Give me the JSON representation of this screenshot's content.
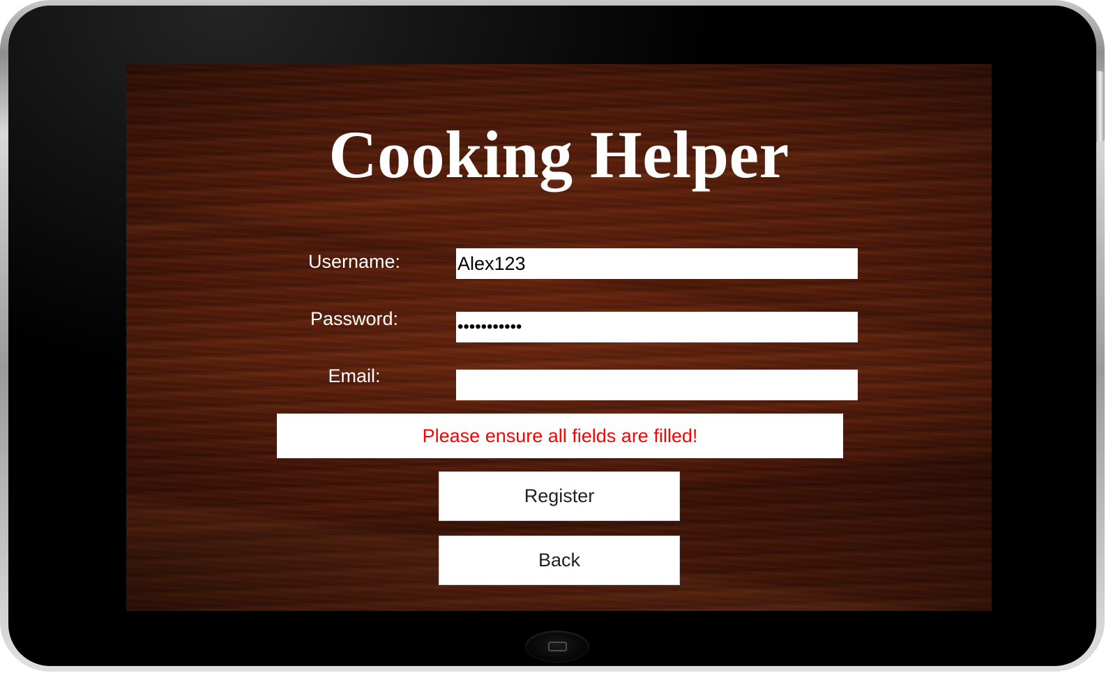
{
  "app": {
    "title": "Cooking Helper"
  },
  "form": {
    "username": {
      "label": "Username:",
      "value": "Alex123"
    },
    "password": {
      "label": "Password:",
      "value": "•••••••••••"
    },
    "email": {
      "label": "Email:",
      "value": ""
    }
  },
  "error": {
    "message": "Please ensure all fields are filled!",
    "color": "#ff0000"
  },
  "buttons": {
    "register": "Register",
    "back": "Back"
  },
  "device": {
    "home_icon": "home-button-icon"
  }
}
